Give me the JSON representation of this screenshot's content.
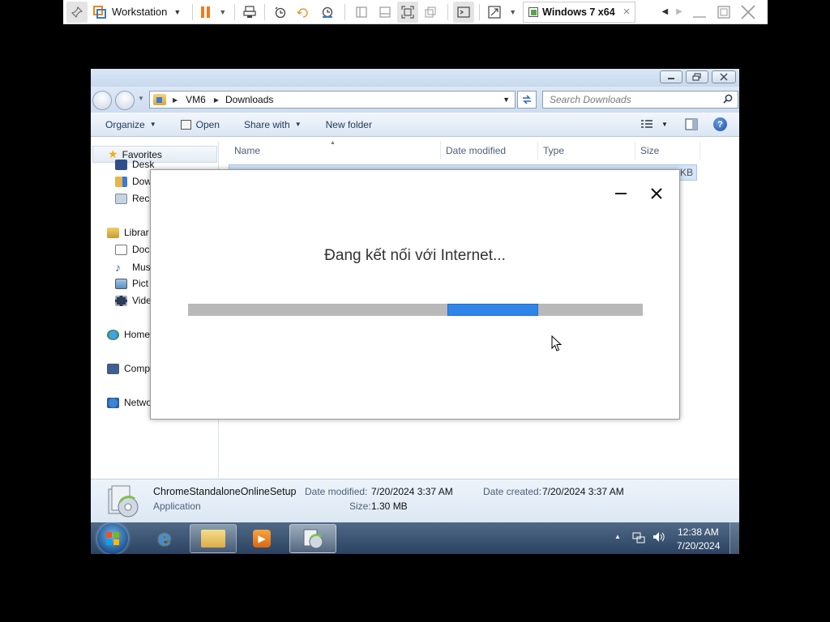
{
  "vmware": {
    "app_name": "Workstation",
    "vm_tab": "Windows 7 x64",
    "tab_close": "×"
  },
  "explorer": {
    "breadcrumb": [
      "VM6",
      "Downloads"
    ],
    "search_placeholder": "Search Downloads",
    "commands": [
      "Organize",
      "Open",
      "Share with",
      "New folder"
    ],
    "nav": {
      "favorites": "Favorites",
      "favorites_items": [
        "Desk",
        "Dow",
        "Rece"
      ],
      "libraries": "Librar",
      "library_items": [
        "Doc",
        "Mus",
        "Pict",
        "Vide"
      ],
      "homegroup": "Home",
      "computer": "Comp",
      "network": "Netwo"
    },
    "columns": [
      "Name",
      "Date modified",
      "Type",
      "Size"
    ],
    "file_size_fragment": "KB",
    "details": {
      "filename": "ChromeStandaloneOnlineSetup",
      "type": "Application",
      "date_modified_label": "Date modified:",
      "date_modified": "7/20/2024 3:37 AM",
      "date_created_label": "Date created:",
      "date_created": "7/20/2024 3:37 AM",
      "size_label": "Size:",
      "size": "1.30 MB"
    }
  },
  "taskbar": {
    "time": "12:38 AM",
    "date": "7/20/2024"
  },
  "dialog": {
    "message": "Đang kết nối với Internet...",
    "progress_chunk_start": 0.57,
    "progress_chunk_end": 0.77
  },
  "colors": {
    "progress_blue": "#2f86e8",
    "progress_track": "#b9b9b9"
  }
}
